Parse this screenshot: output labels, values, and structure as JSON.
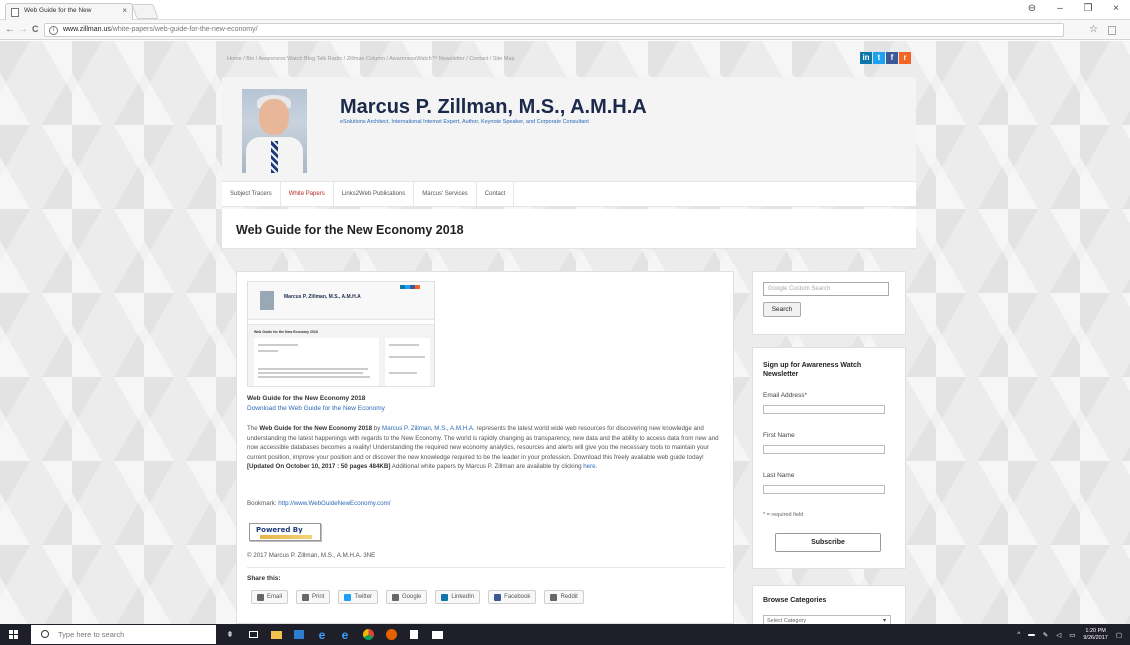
{
  "browser": {
    "tab_title": "Web Guide for the New",
    "tab_close": "×",
    "url_domain": "www.zillman.us",
    "url_path": "/white-papers/web-guide-for-the-new-economy/",
    "back": "←",
    "forward": "→",
    "reload": "C",
    "info": "i",
    "star": "☆",
    "window_controls": [
      "⊖",
      "–",
      "❐",
      "×"
    ]
  },
  "topbar": {
    "links": "Home  /  Bio  /  Awareness Watch Blog Talk Radio  /  Zillman Column  /  AwarenessWatch™ Newsletter  /  Contact  /  Site Map"
  },
  "social": {
    "linkedin": "in",
    "twitter": "t",
    "facebook": "f",
    "rss": "r",
    "colors": {
      "linkedin": "#0e76a8",
      "twitter": "#1da1f2",
      "facebook": "#3b5998",
      "rss": "#f26522"
    }
  },
  "header": {
    "title": "Marcus P. Zillman, M.S., A.M.H.A",
    "tagline": "eSolutions Architect, International Internet Expert, Author, Keynote Speaker, and Corporate Consultant"
  },
  "nav": {
    "items": [
      {
        "label": "Subject Tracers"
      },
      {
        "label": "White Papers"
      },
      {
        "label": "Links2Web Publications"
      },
      {
        "label": "Marcus' Services"
      },
      {
        "label": "Contact"
      }
    ]
  },
  "page": {
    "title": "Web Guide for the New Economy 2018"
  },
  "thumbnail": {
    "title": "Marcus P. Zillman, M.S., A.M.H.A",
    "page_title": "Web Guide for the New Economy 2018"
  },
  "content": {
    "guide_title": "Web Guide for the New Economy 2018",
    "download_link": "Download the Web Guide for the New Economy",
    "body_pre": "The ",
    "body_bold": "Web Guide for the New Economy 2018",
    "body_by": " by ",
    "body_author": "Marcus P. Zillman, M.S., A.M.H.A.",
    "body_main": " represents the latest world wide web resources for discovering new knowledge and understanding the latest happenings with regards to the New Economy. The world is rapidly changing as transparency, new data and the ability to access data from new and now accessible databases becomes a reality! Understanding the required new economy analytics, resources and alerts will give you the necessary tools to maintain your current position, improve your position and or discover the new knowledge required to be the leader in your profession. Download this freely available web guide today! ",
    "body_updated": "[Updated On October 10, 2017 : 50 pages 484KB]",
    "body_tail": " Additional white papers by Marcus P. Zillman are available by clicking ",
    "body_here": "here",
    "body_end": ".",
    "bookmark_label": "Bookmark: ",
    "bookmark_url": "http://www.WebGuideNewEconomy.com/",
    "powered_by": "Powered By",
    "copyright": "© 2017 Marcus P. Zillman, M.S., A.M.H.A. 3NE",
    "share_label": "Share this:",
    "share_buttons": [
      {
        "label": "Email"
      },
      {
        "label": "Print"
      },
      {
        "label": "Twitter"
      },
      {
        "label": "Google"
      },
      {
        "label": "LinkedIn"
      },
      {
        "label": "Facebook"
      },
      {
        "label": "Reddit"
      }
    ]
  },
  "sidebar": {
    "search_placeholder": "Google Custom Search",
    "search_button": "Search",
    "signup_title": "Sign up for Awareness Watch Newsletter",
    "email_label": "Email Address*",
    "first_name_label": "First Name",
    "last_name_label": "Last Name",
    "required_note": "* = required field",
    "subscribe_button": "Subscribe",
    "browse_title": "Browse Categories",
    "browse_select": "Select Category"
  },
  "taskbar": {
    "search_placeholder": "Type here to search",
    "time": "1:20 PM",
    "date": "9/26/2017"
  }
}
